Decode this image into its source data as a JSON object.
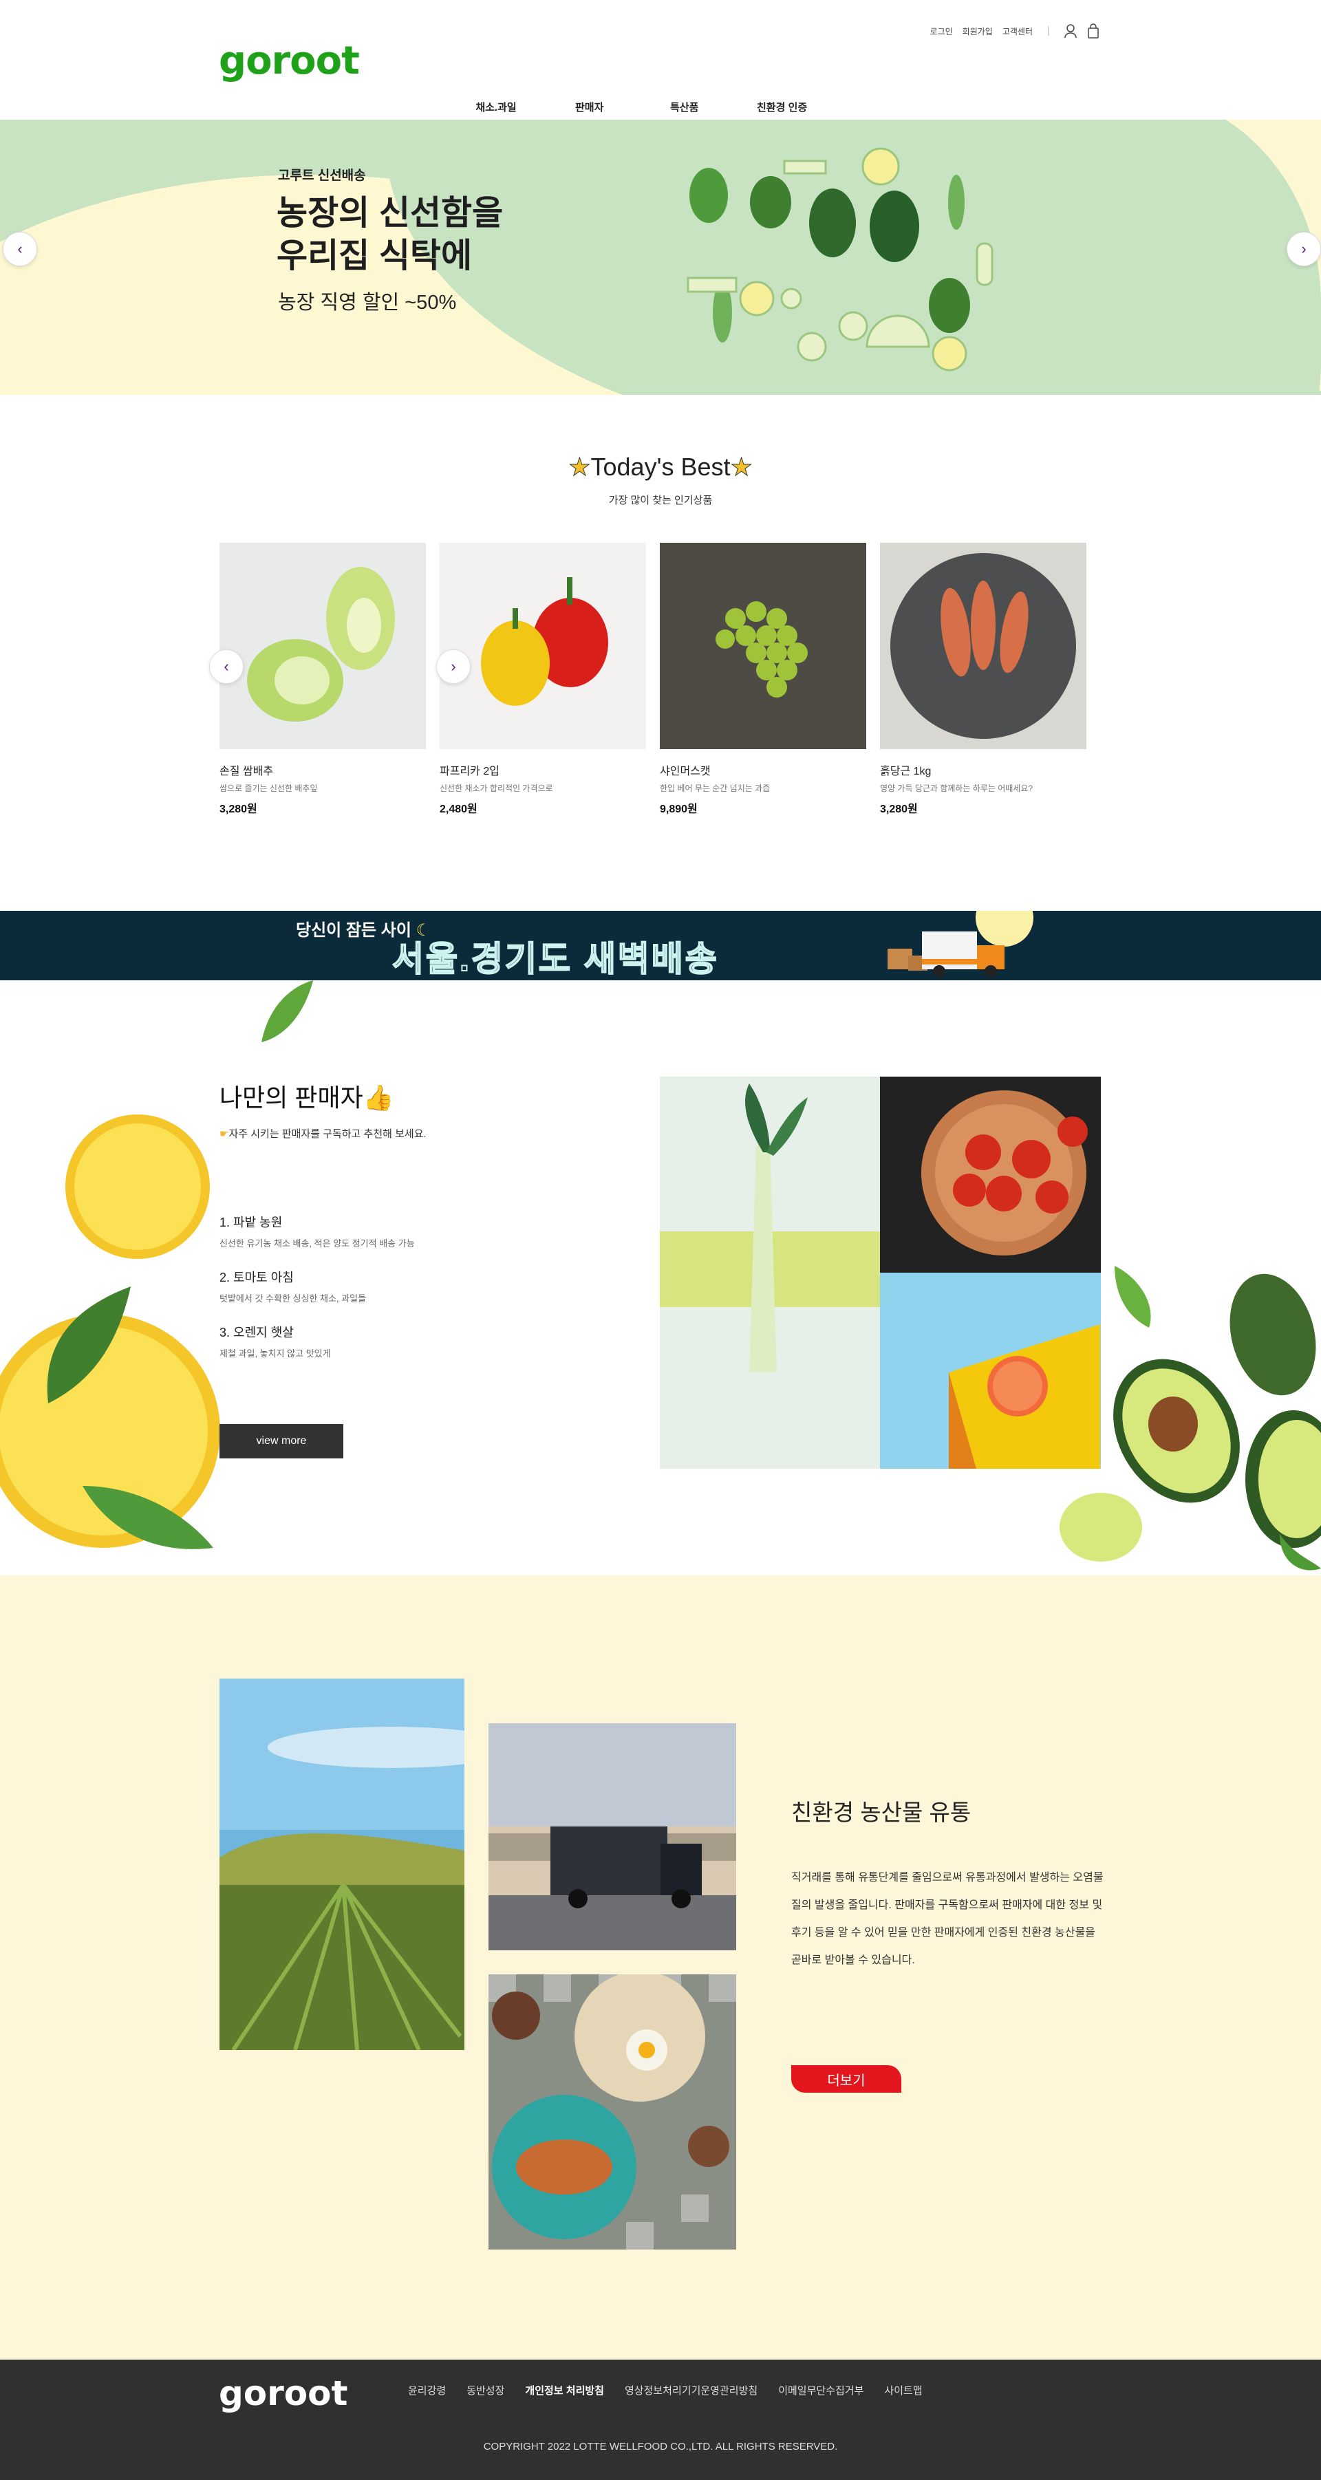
{
  "header": {
    "logo": "goroot",
    "util": {
      "login": "로그인",
      "join": "회원가입",
      "cs": "고객센터"
    },
    "icons": [
      "user-icon",
      "shopping-bag-icon"
    ],
    "nav": [
      "채소.과일",
      "판매자",
      "특산품",
      "친환경 인증"
    ]
  },
  "hero": {
    "sub": "고루트 신선배송",
    "title_line1": "농장의 신선함을",
    "title_line2": "우리집 식탁에",
    "discount": "농장 직영 할인 ~50%",
    "prev": "‹",
    "next": "›"
  },
  "best": {
    "title": "Today's Best",
    "sub": "가장 많이 찾는 인기상품",
    "items": [
      {
        "name": "손질 쌈배추",
        "desc": "쌈으로 즐기는 신선한 배추잎",
        "price": "3,280원"
      },
      {
        "name": "파프리카 2입",
        "desc": "신선한 채소가 합리적인 가격으로",
        "price": "2,480원"
      },
      {
        "name": "샤인머스캣",
        "desc": "한입 베어 무는 순간 넘치는 과즙",
        "price": "9,890원"
      },
      {
        "name": "흙당근 1kg",
        "desc": "영양 가득 당근과 함께하는 하루는 어때세요?",
        "price": "3,280원"
      }
    ]
  },
  "banner": {
    "line1": "당신이 잠든 사이",
    "line2": "서울.경기도 새벽배송"
  },
  "sellers": {
    "title": "나만의 판매자",
    "sub": "자주 시키는 판매자를 구독하고 추천해 보세요.",
    "items": [
      {
        "name": "1. 파밭 농원",
        "desc": "신선한 유기농 채소 배송, 적은 양도 정기적 배송 가능"
      },
      {
        "name": "2. 토마토 아침",
        "desc": "텃밭에서 갓 수확한 싱싱한 채소, 과일들"
      },
      {
        "name": "3. 오렌지 햇살",
        "desc": "제철 과일, 놓치지 않고 맛있게"
      }
    ],
    "button": "view more"
  },
  "eco": {
    "title": "친환경 농산물 유통",
    "body": "직거래를 통해 유통단계를 줄임으로써 유통과정에서 발생하는 오염물질의 발생을 줄입니다. 판매자를 구독함으로써 판매자에 대한 정보 및 후기 등을 알 수 있어 믿을 만한 판매자에게 인증된 친환경 농산물을 곧바로 받아볼 수 있습니다.",
    "button": "더보기"
  },
  "footer": {
    "logo": "goroot",
    "links": [
      "윤리강령",
      "동반성장",
      "개인정보 처리방침",
      "영상정보처리기기운영관리방침",
      "이메일무단수집거부",
      "사이트맵"
    ],
    "copyright": "COPYRIGHT 2022 LOTTE WELLFOOD CO.,LTD. ALL RIGHTS RESERVED."
  }
}
